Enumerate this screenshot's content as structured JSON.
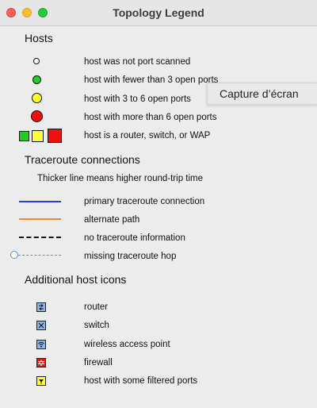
{
  "window": {
    "title": "Topology Legend"
  },
  "hosts": {
    "heading": "Hosts",
    "items": [
      "host was not port scanned",
      "host with fewer than 3 open ports",
      "host with 3 to 6 open ports",
      "host with more than 6 open ports",
      "host is a router, switch, or WAP"
    ],
    "colors": {
      "green": "#22cc22",
      "yellow": "#ffff33",
      "red": "#ee1111",
      "white": "#ffffff"
    }
  },
  "traceroute": {
    "heading": "Traceroute connections",
    "note": "Thicker line means higher round-trip time",
    "items": [
      "primary traceroute connection",
      "alternate path",
      "no traceroute information",
      "missing traceroute hop"
    ],
    "colors": {
      "primary": "#1f3fd6",
      "alternate": "#f08a3c",
      "none": "#111111",
      "missing": "#5b8fd6"
    }
  },
  "additional": {
    "heading": "Additional host icons",
    "items": [
      {
        "label": "router",
        "icon": "router-icon"
      },
      {
        "label": "switch",
        "icon": "switch-icon"
      },
      {
        "label": "wireless access point",
        "icon": "wireless-icon"
      },
      {
        "label": "firewall",
        "icon": "firewall-icon"
      },
      {
        "label": "host with some filtered ports",
        "icon": "filtered-icon"
      }
    ]
  },
  "tooltip": {
    "text": "Capture d’écran"
  }
}
